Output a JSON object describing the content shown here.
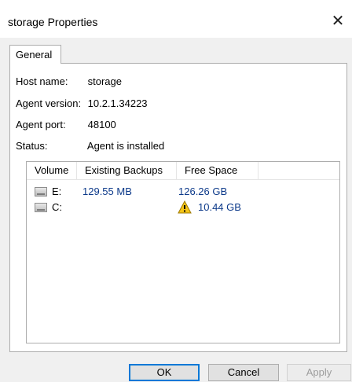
{
  "window": {
    "title": "storage Properties",
    "close_glyph": "✕"
  },
  "tabs": [
    {
      "label": "General",
      "selected": true
    }
  ],
  "general": {
    "host_name_label": "Host name:",
    "host_name_value": "storage",
    "agent_version_label": "Agent version:",
    "agent_version_value": "10.2.1.34223",
    "agent_port_label": "Agent port:",
    "agent_port_value": "48100",
    "status_label": "Status:",
    "status_value": "Agent is installed"
  },
  "volumes_table": {
    "columns": [
      "Volume",
      "Existing Backups",
      "Free Space"
    ],
    "rows": [
      {
        "icon": "drive-icon",
        "volume": "E:",
        "existing_backups": "129.55 MB",
        "free_space": "126.26 GB",
        "warning": false
      },
      {
        "icon": "drive-icon",
        "volume": "C:",
        "existing_backups": "",
        "free_space": "10.44 GB",
        "warning": true
      }
    ]
  },
  "buttons": {
    "ok": "OK",
    "cancel": "Cancel",
    "apply": "Apply"
  },
  "colors": {
    "value_text": "#0d3a8a",
    "warning_fill": "#f5c518"
  }
}
